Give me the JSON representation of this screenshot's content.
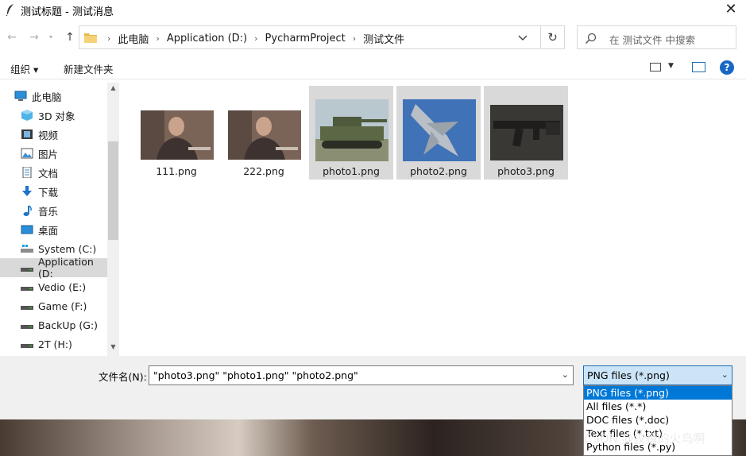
{
  "window": {
    "title": "测试标题 - 测试消息"
  },
  "navigation": {
    "address_path": [
      "此电脑",
      "Application (D:)",
      "PycharmProject",
      "测试文件"
    ],
    "search_placeholder": "在 测试文件 中搜索"
  },
  "toolbar": {
    "organize_label": "组织 ▾",
    "new_folder_label": "新建文件夹",
    "help_label": "?"
  },
  "sidebar": {
    "items": [
      {
        "label": "此电脑",
        "icon": "computer-icon"
      },
      {
        "label": "3D 对象",
        "icon": "3d-objects-icon"
      },
      {
        "label": "视频",
        "icon": "video-icon"
      },
      {
        "label": "图片",
        "icon": "pictures-icon"
      },
      {
        "label": "文档",
        "icon": "documents-icon"
      },
      {
        "label": "下载",
        "icon": "download-icon"
      },
      {
        "label": "音乐",
        "icon": "music-icon"
      },
      {
        "label": "桌面",
        "icon": "desktop-icon"
      },
      {
        "label": "System (C:)",
        "icon": "drive-icon"
      },
      {
        "label": "Application (D:",
        "icon": "drive-icon",
        "selected": true
      },
      {
        "label": "Vedio (E:)",
        "icon": "drive-icon"
      },
      {
        "label": "Game (F:)",
        "icon": "drive-icon"
      },
      {
        "label": "BackUp (G:)",
        "icon": "drive-icon"
      },
      {
        "label": "2T (H:)",
        "icon": "drive-icon"
      }
    ]
  },
  "files": [
    {
      "name": "111.png",
      "selected": false
    },
    {
      "name": "222.png",
      "selected": false
    },
    {
      "name": "photo1.png",
      "selected": true
    },
    {
      "name": "photo2.png",
      "selected": true
    },
    {
      "name": "photo3.png",
      "selected": true
    }
  ],
  "footer": {
    "filename_label": "文件名(N):",
    "filename_value": "\"photo3.png\" \"photo1.png\" \"photo2.png\"",
    "filetype_value": "PNG files (*.png)",
    "filetype_options": [
      "PNG files (*.png)",
      "All files (*.*)",
      "DOC files (*.doc)",
      "Text files (*.txt)",
      "Python files (*.py)"
    ]
  },
  "watermark": "CSDN @狡猾的火鸟啊",
  "colors": {
    "accent": "#0078d7",
    "selection": "#d9d9d9",
    "bottom_panel": "#f0f0f0"
  }
}
